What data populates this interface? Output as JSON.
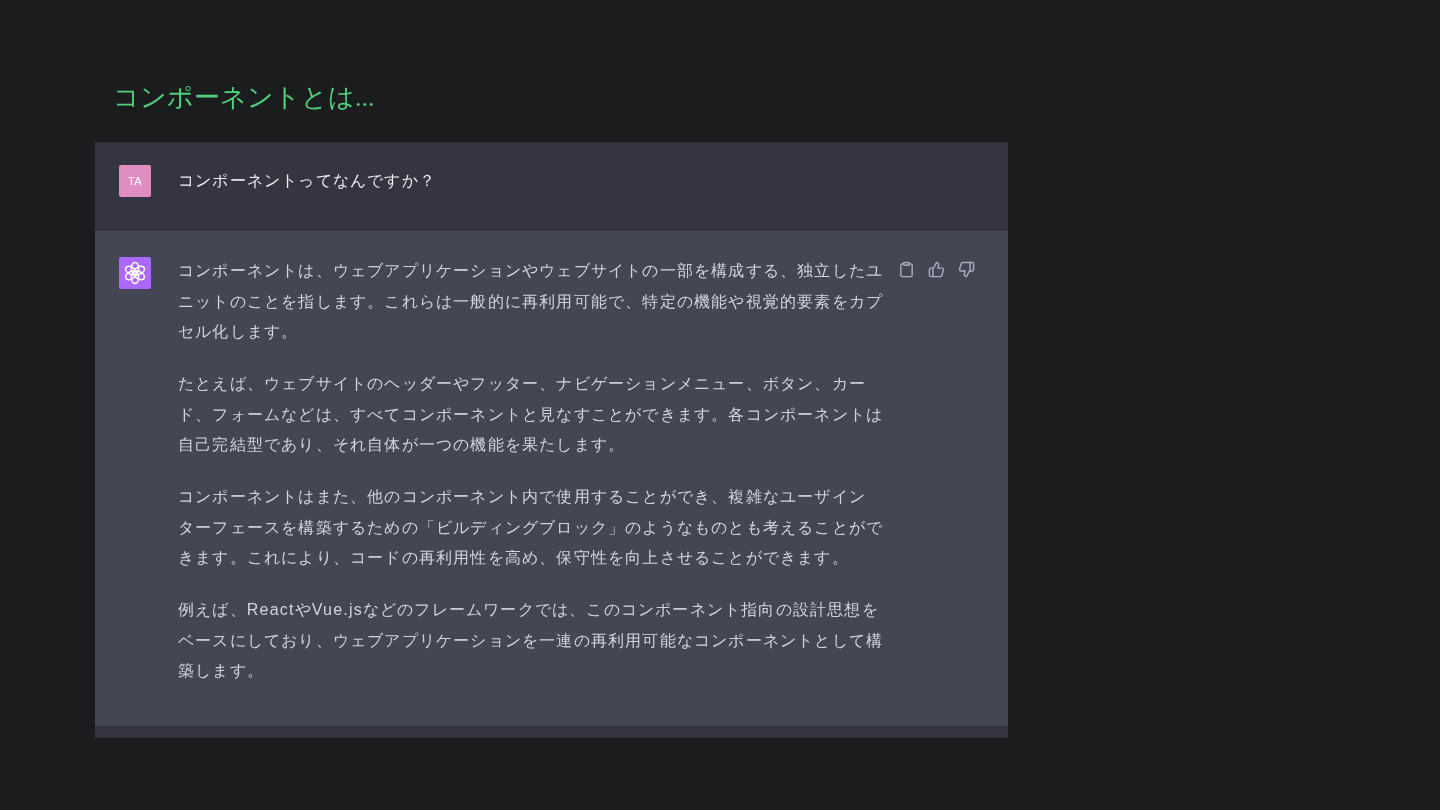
{
  "title": "コンポーネントとは...",
  "messages": [
    {
      "kind": "user",
      "avatar": "TA",
      "paragraphs": [
        "コンポーネントってなんですか？"
      ]
    },
    {
      "kind": "assistant",
      "paragraphs": [
        "コンポーネントは、ウェブアプリケーションやウェブサイトの一部を構成する、独立したユニットのことを指します。これらは一般的に再利用可能で、特定の機能や視覚的要素をカプセル化します。",
        "たとえば、ウェブサイトのヘッダーやフッター、ナビゲーションメニュー、ボタン、カード、フォームなどは、すべてコンポーネントと見なすことができます。各コンポーネントは自己完結型であり、それ自体が一つの機能を果たします。",
        "コンポーネントはまた、他のコンポーネント内で使用することができ、複雑なユーザインターフェースを構築するための「ビルディングブロック」のようなものとも考えることができます。これにより、コードの再利用性を高め、保守性を向上させることができます。",
        "例えば、ReactやVue.jsなどのフレームワークでは、このコンポーネント指向の設計思想をベースにしており、ウェブアプリケーションを一連の再利用可能なコンポーネントとして構築します。"
      ]
    }
  ]
}
